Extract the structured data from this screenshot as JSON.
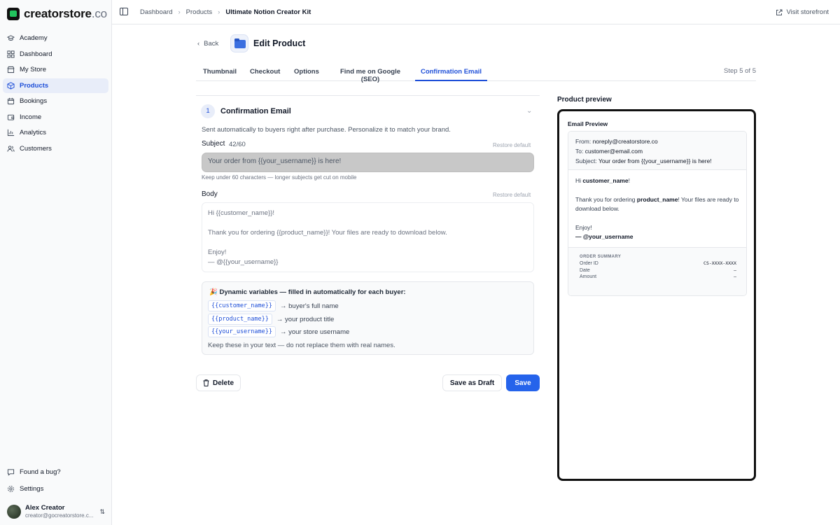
{
  "brand": {
    "name": "creatorstore",
    "tld": ".co"
  },
  "sidebar": {
    "items": [
      {
        "label": "Academy",
        "icon": "graduation-cap-icon"
      },
      {
        "label": "Dashboard",
        "icon": "grid-icon"
      },
      {
        "label": "My Store",
        "icon": "store-icon"
      },
      {
        "label": "Products",
        "icon": "package-icon",
        "active": true
      },
      {
        "label": "Bookings",
        "icon": "calendar-icon"
      },
      {
        "label": "Income",
        "icon": "wallet-icon"
      },
      {
        "label": "Analytics",
        "icon": "chart-icon"
      },
      {
        "label": "Customers",
        "icon": "users-icon"
      }
    ],
    "bottom": [
      {
        "label": "Found a bug?",
        "icon": "message-icon"
      },
      {
        "label": "Settings",
        "icon": "gear-icon"
      }
    ],
    "user": {
      "name": "Alex Creator",
      "email": "creator@gocreatorstore.c..."
    }
  },
  "header": {
    "breadcrumbs": [
      "Dashboard",
      "Products",
      "Ultimate Notion Creator Kit"
    ],
    "visit_label": "Visit storefront"
  },
  "page": {
    "back_label": "Back",
    "title": "Edit Product",
    "tabs": [
      "Thumbnail",
      "Checkout",
      "Options",
      "Find me on Google (SEO)",
      "Confirmation Email"
    ],
    "active_tab": "Confirmation Email",
    "step": "Step 5 of 5"
  },
  "section": {
    "number": "1",
    "title": "Confirmation Email",
    "description": "Sent automatically to buyers right after purchase. Personalize it to match your brand.",
    "subject_label": "Subject",
    "subject_counter": "42/60",
    "restore_label": "Restore default",
    "subject_value": "Your order from {{your_username}} is here!",
    "subject_hint": "Keep under 60 characters — longer subjects get cut on mobile",
    "body_label": "Body",
    "body_lines": {
      "l1": "Hi {{customer_name}}!",
      "l2": "Thank you for ordering {{product_name}}! Your files are ready to download below.",
      "l3": "Enjoy!",
      "l4": "— @{{your_username}}"
    }
  },
  "variables": {
    "title": "Dynamic variables — filled in automatically for each buyer:",
    "icon": "party-popper-icon",
    "rows": [
      {
        "code": "{{customer_name}}",
        "desc": "→ buyer's full name"
      },
      {
        "code": "{{product_name}}",
        "desc": "→ your product title"
      },
      {
        "code": "{{your_username}}",
        "desc": "→ your store username"
      }
    ],
    "note": "Keep these in your text — do not replace them with real names."
  },
  "actions": {
    "delete": "Delete",
    "draft": "Save as Draft",
    "save": "Save"
  },
  "preview": {
    "label": "Product preview",
    "title": "Email Preview",
    "from_key": "From:",
    "from_val": "noreply@creatorstore.co",
    "to_key": "To:",
    "to_val": "customer@email.com",
    "subject_key": "Subject:",
    "subject_val": "Your order from {{your_username}} is here!",
    "greet_pre": "Hi ",
    "greet_name": "customer_name",
    "greet_post": "!",
    "thanks_pre": "Thank you for ordering ",
    "thanks_product": "product_name",
    "thanks_post": "! Your files are ready to download below.",
    "enjoy": "Enjoy!",
    "signoff": "— @your_username",
    "order_title": "ORDER SUMMARY",
    "order_rows": [
      {
        "k": "Order ID",
        "v": "CS-XXXX-XXXX"
      },
      {
        "k": "Date",
        "v": "—"
      },
      {
        "k": "Amount",
        "v": "—"
      }
    ]
  },
  "colors": {
    "accent": "#2563eb",
    "active_bg": "#e8edf9",
    "logo_green": "#22c55e"
  }
}
